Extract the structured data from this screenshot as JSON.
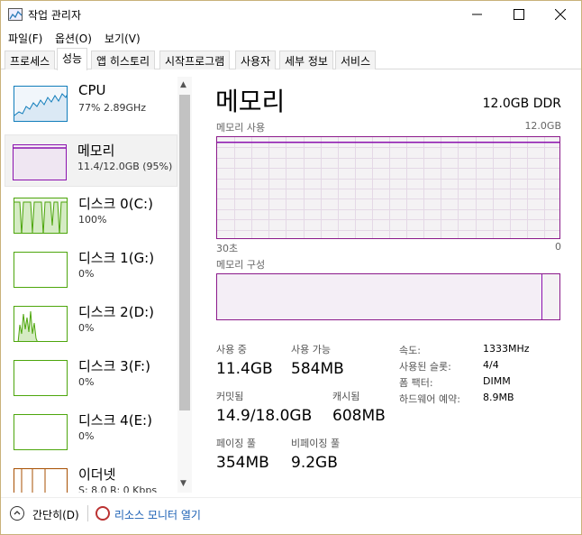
{
  "window": {
    "title": "작업 관리자"
  },
  "menu": [
    "파일(F)",
    "옵션(O)",
    "보기(V)"
  ],
  "tabs": [
    "프로세스",
    "성능",
    "앱 히스토리",
    "시작프로그램",
    "사용자",
    "세부 정보",
    "서비스"
  ],
  "active_tab": "성능",
  "sidebar": {
    "items": [
      {
        "name": "CPU",
        "sub": "77%  2.89GHz",
        "color": "#117dbb"
      },
      {
        "name": "메모리",
        "sub": "11.4/12.0GB (95%)",
        "color": "#8b12ae"
      },
      {
        "name": "디스크 0(C:)",
        "sub": "100%",
        "color": "#4da60c"
      },
      {
        "name": "디스크 1(G:)",
        "sub": "0%",
        "color": "#4da60c"
      },
      {
        "name": "디스크 2(D:)",
        "sub": "0%",
        "color": "#4da60c"
      },
      {
        "name": "디스크 3(F:)",
        "sub": "0%",
        "color": "#4da60c"
      },
      {
        "name": "디스크 4(E:)",
        "sub": "0%",
        "color": "#4da60c"
      },
      {
        "name": "이더넷",
        "sub": "S: 8.0  R: 0 Kbps",
        "color": "#a74f01"
      }
    ]
  },
  "main": {
    "title": "메모리",
    "spec": "12.0GB DDR",
    "usage_label": "메모리 사용",
    "usage_max": "12.0GB",
    "time_left": "30초",
    "time_right": "0",
    "usage_level": 0.95,
    "composition_label": "메모리 구성",
    "composition_in_use": 0.95,
    "stats": {
      "in_use_label": "사용 중",
      "in_use": "11.4GB",
      "available_label": "사용 가능",
      "available": "584MB",
      "committed_label": "커밋됨",
      "committed": "14.9/18.0GB",
      "cached_label": "캐시됨",
      "cached": "608MB",
      "paged_label": "페이징 풀",
      "paged": "354MB",
      "nonpaged_label": "비페이징 풀",
      "nonpaged": "9.2GB"
    },
    "details": [
      {
        "label": "속도:",
        "value": "1333MHz"
      },
      {
        "label": "사용된 슬롯:",
        "value": "4/4"
      },
      {
        "label": "폼 팩터:",
        "value": "DIMM"
      },
      {
        "label": "하드웨어 예약:",
        "value": "8.9MB"
      }
    ]
  },
  "footer": {
    "fewer_details": "간단히(D)",
    "resource_monitor": "리소스 모니터 열기"
  }
}
